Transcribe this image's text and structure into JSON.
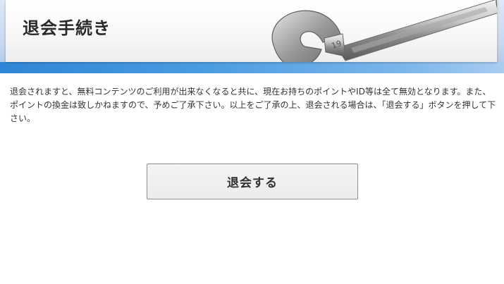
{
  "header": {
    "title": "退会手続き"
  },
  "main": {
    "description": "退会されますと、無料コンテンツのご利用が出来なくなると共に、現在お持ちのポイントやID等は全て無効となります。また、ポイントの換金は致しかねますので、予めご了承下さい。以上をご了承の上、退会される場合は、「退会する」ボタンを押して下さい。",
    "withdraw_button_label": "退会する"
  },
  "colors": {
    "banner_blue": "#2f86d6",
    "button_background": "#efefef",
    "button_border": "#8e8e8e",
    "text": "#333333"
  },
  "icons": {
    "banner_image": "wrench-icon"
  }
}
